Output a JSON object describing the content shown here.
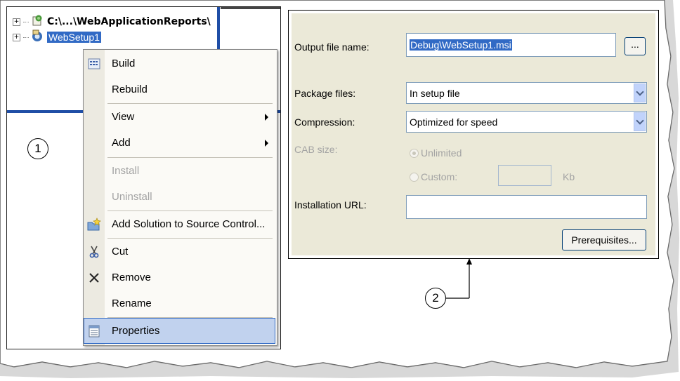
{
  "tree": {
    "root_label": "C:\\...\\WebApplicationReports\\",
    "selected_label": "WebSetup1",
    "expander_glyph": "+"
  },
  "context_menu": {
    "items": [
      {
        "label": "Build",
        "icon": "build-icon",
        "enabled": true
      },
      {
        "label": "Rebuild",
        "icon": "",
        "enabled": true
      },
      {
        "label": "View",
        "icon": "",
        "enabled": true,
        "submenu": true
      },
      {
        "label": "Add",
        "icon": "",
        "enabled": true,
        "submenu": true
      },
      {
        "label": "Install",
        "icon": "",
        "enabled": false
      },
      {
        "label": "Uninstall",
        "icon": "",
        "enabled": false
      },
      {
        "label": "Add Solution to Source Control...",
        "icon": "source-control-icon",
        "enabled": true
      },
      {
        "label": "Cut",
        "icon": "scissors-icon",
        "enabled": true
      },
      {
        "label": "Remove",
        "icon": "remove-x-icon",
        "enabled": true
      },
      {
        "label": "Rename",
        "icon": "",
        "enabled": true
      },
      {
        "label": "Properties",
        "icon": "properties-icon",
        "enabled": true,
        "selected": true
      }
    ]
  },
  "callouts": {
    "one": "1",
    "two": "2"
  },
  "dialog": {
    "output_file_label": "Output file name:",
    "output_file_value": "Debug\\WebSetup1.msi",
    "browse_button": "...",
    "package_files_label": "Package files:",
    "package_files_value": "In setup file",
    "compression_label": "Compression:",
    "compression_value": "Optimized for speed",
    "cab_size_label": "CAB size:",
    "unlimited_label": "Unlimited",
    "custom_label": "Custom:",
    "kb_label": "Kb",
    "installation_url_label": "Installation URL:",
    "installation_url_value": "",
    "prerequisites_button": "Prerequisites..."
  },
  "colors": {
    "selection": "#316ac5",
    "dialog_bg": "#ebe9d8",
    "menu_highlight": "#c1d2ee",
    "divider_blue": "#1f4ea6"
  }
}
